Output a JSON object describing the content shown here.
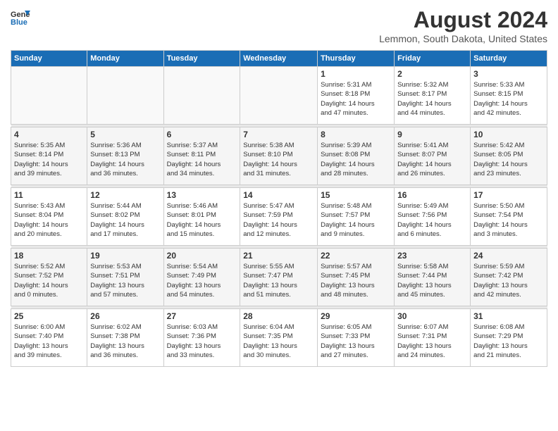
{
  "logo": {
    "general": "General",
    "blue": "Blue"
  },
  "title": "August 2024",
  "subtitle": "Lemmon, South Dakota, United States",
  "weekdays": [
    "Sunday",
    "Monday",
    "Tuesday",
    "Wednesday",
    "Thursday",
    "Friday",
    "Saturday"
  ],
  "weeks": [
    [
      {
        "day": "",
        "info": ""
      },
      {
        "day": "",
        "info": ""
      },
      {
        "day": "",
        "info": ""
      },
      {
        "day": "",
        "info": ""
      },
      {
        "day": "1",
        "info": "Sunrise: 5:31 AM\nSunset: 8:18 PM\nDaylight: 14 hours\nand 47 minutes."
      },
      {
        "day": "2",
        "info": "Sunrise: 5:32 AM\nSunset: 8:17 PM\nDaylight: 14 hours\nand 44 minutes."
      },
      {
        "day": "3",
        "info": "Sunrise: 5:33 AM\nSunset: 8:15 PM\nDaylight: 14 hours\nand 42 minutes."
      }
    ],
    [
      {
        "day": "4",
        "info": "Sunrise: 5:35 AM\nSunset: 8:14 PM\nDaylight: 14 hours\nand 39 minutes."
      },
      {
        "day": "5",
        "info": "Sunrise: 5:36 AM\nSunset: 8:13 PM\nDaylight: 14 hours\nand 36 minutes."
      },
      {
        "day": "6",
        "info": "Sunrise: 5:37 AM\nSunset: 8:11 PM\nDaylight: 14 hours\nand 34 minutes."
      },
      {
        "day": "7",
        "info": "Sunrise: 5:38 AM\nSunset: 8:10 PM\nDaylight: 14 hours\nand 31 minutes."
      },
      {
        "day": "8",
        "info": "Sunrise: 5:39 AM\nSunset: 8:08 PM\nDaylight: 14 hours\nand 28 minutes."
      },
      {
        "day": "9",
        "info": "Sunrise: 5:41 AM\nSunset: 8:07 PM\nDaylight: 14 hours\nand 26 minutes."
      },
      {
        "day": "10",
        "info": "Sunrise: 5:42 AM\nSunset: 8:05 PM\nDaylight: 14 hours\nand 23 minutes."
      }
    ],
    [
      {
        "day": "11",
        "info": "Sunrise: 5:43 AM\nSunset: 8:04 PM\nDaylight: 14 hours\nand 20 minutes."
      },
      {
        "day": "12",
        "info": "Sunrise: 5:44 AM\nSunset: 8:02 PM\nDaylight: 14 hours\nand 17 minutes."
      },
      {
        "day": "13",
        "info": "Sunrise: 5:46 AM\nSunset: 8:01 PM\nDaylight: 14 hours\nand 15 minutes."
      },
      {
        "day": "14",
        "info": "Sunrise: 5:47 AM\nSunset: 7:59 PM\nDaylight: 14 hours\nand 12 minutes."
      },
      {
        "day": "15",
        "info": "Sunrise: 5:48 AM\nSunset: 7:57 PM\nDaylight: 14 hours\nand 9 minutes."
      },
      {
        "day": "16",
        "info": "Sunrise: 5:49 AM\nSunset: 7:56 PM\nDaylight: 14 hours\nand 6 minutes."
      },
      {
        "day": "17",
        "info": "Sunrise: 5:50 AM\nSunset: 7:54 PM\nDaylight: 14 hours\nand 3 minutes."
      }
    ],
    [
      {
        "day": "18",
        "info": "Sunrise: 5:52 AM\nSunset: 7:52 PM\nDaylight: 14 hours\nand 0 minutes."
      },
      {
        "day": "19",
        "info": "Sunrise: 5:53 AM\nSunset: 7:51 PM\nDaylight: 13 hours\nand 57 minutes."
      },
      {
        "day": "20",
        "info": "Sunrise: 5:54 AM\nSunset: 7:49 PM\nDaylight: 13 hours\nand 54 minutes."
      },
      {
        "day": "21",
        "info": "Sunrise: 5:55 AM\nSunset: 7:47 PM\nDaylight: 13 hours\nand 51 minutes."
      },
      {
        "day": "22",
        "info": "Sunrise: 5:57 AM\nSunset: 7:45 PM\nDaylight: 13 hours\nand 48 minutes."
      },
      {
        "day": "23",
        "info": "Sunrise: 5:58 AM\nSunset: 7:44 PM\nDaylight: 13 hours\nand 45 minutes."
      },
      {
        "day": "24",
        "info": "Sunrise: 5:59 AM\nSunset: 7:42 PM\nDaylight: 13 hours\nand 42 minutes."
      }
    ],
    [
      {
        "day": "25",
        "info": "Sunrise: 6:00 AM\nSunset: 7:40 PM\nDaylight: 13 hours\nand 39 minutes."
      },
      {
        "day": "26",
        "info": "Sunrise: 6:02 AM\nSunset: 7:38 PM\nDaylight: 13 hours\nand 36 minutes."
      },
      {
        "day": "27",
        "info": "Sunrise: 6:03 AM\nSunset: 7:36 PM\nDaylight: 13 hours\nand 33 minutes."
      },
      {
        "day": "28",
        "info": "Sunrise: 6:04 AM\nSunset: 7:35 PM\nDaylight: 13 hours\nand 30 minutes."
      },
      {
        "day": "29",
        "info": "Sunrise: 6:05 AM\nSunset: 7:33 PM\nDaylight: 13 hours\nand 27 minutes."
      },
      {
        "day": "30",
        "info": "Sunrise: 6:07 AM\nSunset: 7:31 PM\nDaylight: 13 hours\nand 24 minutes."
      },
      {
        "day": "31",
        "info": "Sunrise: 6:08 AM\nSunset: 7:29 PM\nDaylight: 13 hours\nand 21 minutes."
      }
    ]
  ]
}
